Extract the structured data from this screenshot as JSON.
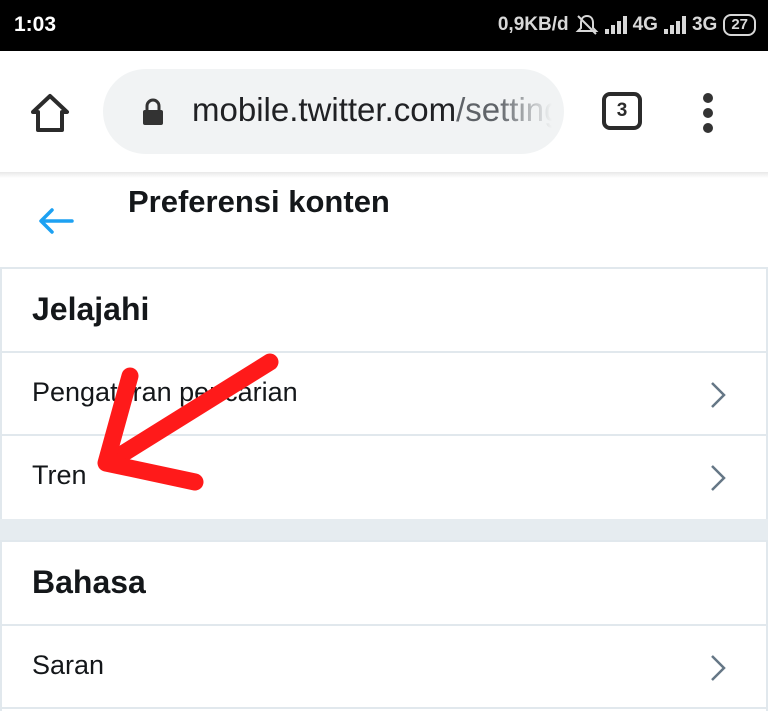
{
  "status_bar": {
    "time": "1:03",
    "speed": "0,9KB/d",
    "network1": "4G",
    "network2": "3G",
    "battery": "27"
  },
  "browser": {
    "url_host": "mobile.twitter.com",
    "url_path": "/settings/content_preferences",
    "tab_count": "3",
    "icons": [
      "home-icon",
      "lock-icon",
      "more-vert-icon"
    ]
  },
  "header": {
    "title": "Preferensi konten"
  },
  "sections": [
    {
      "title": "Jelajahi",
      "items": [
        {
          "label": "Pengaturan pencarian"
        },
        {
          "label": "Tren"
        }
      ]
    },
    {
      "title": "Bahasa",
      "items": [
        {
          "label": "Saran"
        }
      ]
    }
  ],
  "colors": {
    "accent": "#1da1f2",
    "annotation": "#ff1a1a",
    "background": "#e6ecf0"
  }
}
